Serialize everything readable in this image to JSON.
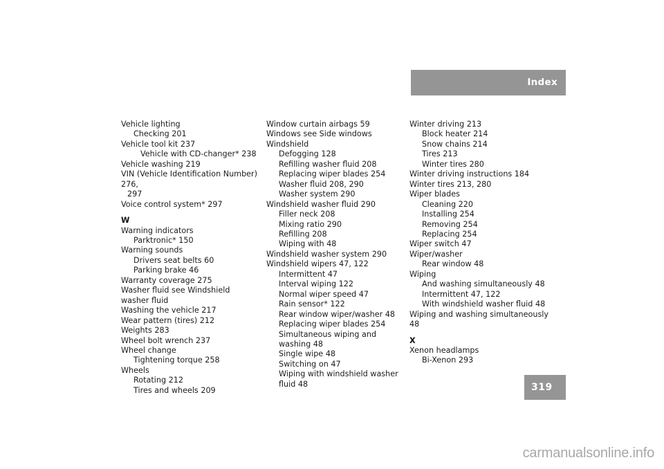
{
  "header": {
    "title": "Index"
  },
  "footer": {
    "page_number": "319",
    "watermark": "carmanualsonline.info"
  },
  "colors": {
    "bar_gray": "#959595",
    "bar_text": "#ffffff",
    "body_text": "#1c1c1c",
    "watermark_gray": "#a8a8a8",
    "page_background": "#ffffff"
  },
  "columns": [
    {
      "id": "column-1",
      "entries": [
        {
          "text": "Vehicle lighting",
          "level": 0
        },
        {
          "text": "Checking 201",
          "level": 1
        },
        {
          "text": "Vehicle tool kit 237",
          "level": 0
        },
        {
          "text": "Vehicle with CD-changer* 238",
          "level": 2
        },
        {
          "text": "Vehicle washing 219",
          "level": 0
        },
        {
          "text": "VIN (Vehicle Identification Number) 276,",
          "level": 0
        },
        {
          "text": "297",
          "level": "cont"
        },
        {
          "text": "Voice control system* 297",
          "level": 0
        },
        {
          "text": "W",
          "level": "letter"
        },
        {
          "text": "Warning indicators",
          "level": 0
        },
        {
          "text": "Parktronic* 150",
          "level": 1
        },
        {
          "text": "Warning sounds",
          "level": 0
        },
        {
          "text": "Drivers seat belts 60",
          "level": 1
        },
        {
          "text": "Parking brake 46",
          "level": 1
        },
        {
          "text": "Warranty coverage 275",
          "level": 0
        },
        {
          "text": "Washer fluid see Windshield washer fluid",
          "level": 0
        },
        {
          "text": "Washing the vehicle 217",
          "level": 0
        },
        {
          "text": "Wear pattern (tires) 212",
          "level": 0
        },
        {
          "text": "Weights 283",
          "level": 0
        },
        {
          "text": "Wheel bolt wrench 237",
          "level": 0
        },
        {
          "text": "Wheel change",
          "level": 0
        },
        {
          "text": "Tightening torque 258",
          "level": 1
        },
        {
          "text": "Wheels",
          "level": 0
        },
        {
          "text": "Rotating 212",
          "level": 1
        },
        {
          "text": "Tires and wheels 209",
          "level": 1
        }
      ]
    },
    {
      "id": "column-2",
      "entries": [
        {
          "text": "Window curtain airbags 59",
          "level": 0
        },
        {
          "text": "Windows see Side windows",
          "level": 0
        },
        {
          "text": "Windshield",
          "level": 0
        },
        {
          "text": "Defogging 128",
          "level": 1
        },
        {
          "text": "Refilling washer fluid 208",
          "level": 1
        },
        {
          "text": "Replacing wiper blades 254",
          "level": 1
        },
        {
          "text": "Washer fluid 208, 290",
          "level": 1
        },
        {
          "text": "Washer system 290",
          "level": 1
        },
        {
          "text": "Windshield washer fluid 290",
          "level": 0
        },
        {
          "text": "Filler neck 208",
          "level": 1
        },
        {
          "text": "Mixing ratio 290",
          "level": 1
        },
        {
          "text": "Refilling 208",
          "level": 1
        },
        {
          "text": "Wiping with 48",
          "level": 1
        },
        {
          "text": "Windshield washer system 290",
          "level": 0
        },
        {
          "text": "Windshield wipers 47, 122",
          "level": 0
        },
        {
          "text": "Intermittent 47",
          "level": 1
        },
        {
          "text": "Interval wiping 122",
          "level": 1
        },
        {
          "text": "Normal wiper speed 47",
          "level": 1
        },
        {
          "text": "Rain sensor* 122",
          "level": 1
        },
        {
          "text": "Rear window wiper/washer 48",
          "level": 1
        },
        {
          "text": "Replacing wiper blades 254",
          "level": 1
        },
        {
          "text": "Simultaneous wiping and washing 48",
          "level": 1
        },
        {
          "text": "Single wipe 48",
          "level": 1
        },
        {
          "text": "Switching on 47",
          "level": 1
        },
        {
          "text": "Wiping with windshield washer fluid 48",
          "level": 1
        }
      ]
    },
    {
      "id": "column-3",
      "entries": [
        {
          "text": "Winter driving 213",
          "level": 0
        },
        {
          "text": "Block heater 214",
          "level": 1
        },
        {
          "text": "Snow chains 214",
          "level": 1
        },
        {
          "text": "Tires 213",
          "level": 1
        },
        {
          "text": "Winter tires 280",
          "level": 1
        },
        {
          "text": "Winter driving instructions 184",
          "level": 0
        },
        {
          "text": "Winter tires 213, 280",
          "level": 0
        },
        {
          "text": "Wiper blades",
          "level": 0
        },
        {
          "text": "Cleaning 220",
          "level": 1
        },
        {
          "text": "Installing 254",
          "level": 1
        },
        {
          "text": "Removing 254",
          "level": 1
        },
        {
          "text": "Replacing 254",
          "level": 1
        },
        {
          "text": "Wiper switch 47",
          "level": 0
        },
        {
          "text": "Wiper/washer",
          "level": 0
        },
        {
          "text": "Rear window 48",
          "level": 1
        },
        {
          "text": "Wiping",
          "level": 0
        },
        {
          "text": "And washing simultaneously 48",
          "level": 1
        },
        {
          "text": "Intermittent 47, 122",
          "level": 1
        },
        {
          "text": "With windshield washer fluid 48",
          "level": 1
        },
        {
          "text": "Wiping and washing simultaneously 48",
          "level": 0
        },
        {
          "text": "X",
          "level": "letter"
        },
        {
          "text": "Xenon headlamps",
          "level": 0
        },
        {
          "text": "Bi-Xenon 293",
          "level": 1
        }
      ]
    }
  ]
}
